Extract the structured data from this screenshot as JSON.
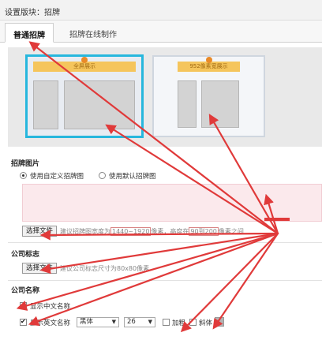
{
  "header": {
    "title": "设置版块：招牌"
  },
  "tabs": [
    {
      "label": "普通招牌"
    },
    {
      "label": "招牌在线制作"
    }
  ],
  "preview": {
    "option1_banner": "全屏展示",
    "option2_banner": "952像素宽展示"
  },
  "sign_image": {
    "title": "招牌图片",
    "radio_custom": "使用自定义招牌图",
    "radio_default": "使用默认招牌图",
    "choose_file": "选择文件",
    "hint_prefix": "建议招牌图宽度为",
    "hint_width": "1440~1920",
    "hint_mid": "像素，高度在",
    "hint_height": "90到200",
    "hint_suffix": "像素之间"
  },
  "company_logo": {
    "title": "公司标志",
    "choose_file": "选择文件",
    "hint": "建议公司标志尺寸为80x80像素"
  },
  "company_name": {
    "title": "公司名称",
    "show_cn_label": "显示中文名称",
    "show_cn_checked": false,
    "show_en_label": "显示英文名称",
    "show_en_checked": true,
    "font": "黑体",
    "size": "26",
    "bold_label": "加粗",
    "italic_label": "斜体",
    "color": "#b3b3b3"
  },
  "annotation_color": "#e03a3a"
}
